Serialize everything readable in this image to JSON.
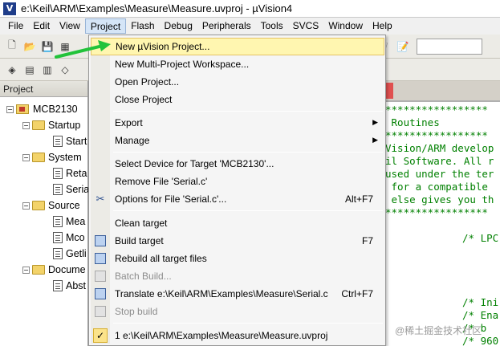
{
  "window": {
    "title": "e:\\Keil\\ARM\\Examples\\Measure\\Measure.uvproj - µVision4",
    "app_icon_letter": "V"
  },
  "menubar": {
    "items": [
      "File",
      "Edit",
      "View",
      "Project",
      "Flash",
      "Debug",
      "Peripherals",
      "Tools",
      "SVCS",
      "Window",
      "Help"
    ]
  },
  "project_panel": {
    "header": "Project",
    "tree": [
      {
        "label": "MCB2130",
        "kind": "target",
        "expander": "−"
      },
      {
        "label": "Startup",
        "kind": "folder",
        "expander": "−"
      },
      {
        "label": "Start",
        "kind": "file"
      },
      {
        "label": "System",
        "kind": "folder",
        "expander": "−"
      },
      {
        "label": "Reta",
        "kind": "file"
      },
      {
        "label": "Seria",
        "kind": "file"
      },
      {
        "label": "Source",
        "kind": "folder",
        "expander": "−"
      },
      {
        "label": "Mea",
        "kind": "file"
      },
      {
        "label": "Mco",
        "kind": "file"
      },
      {
        "label": "Getli",
        "kind": "file"
      },
      {
        "label": "Docume",
        "kind": "folder",
        "expander": "−"
      },
      {
        "label": "Abst",
        "kind": "file"
      }
    ]
  },
  "editor": {
    "lines": [
      "*****************",
      " Routines",
      "*****************",
      "Vision/ARM develop",
      "il Software. All r",
      "used under the ter",
      " for a compatible",
      " else gives you th",
      "*****************",
      "/* LPC",
      "/* Ini",
      "/* Ena",
      "/* b",
      "/* 960"
    ]
  },
  "project_menu": {
    "items": [
      {
        "label": "New µVision Project...",
        "shortcut": "",
        "highlighted": true
      },
      {
        "label": "New Multi-Project Workspace...",
        "shortcut": ""
      },
      {
        "label": "Open Project...",
        "shortcut": ""
      },
      {
        "label": "Close Project",
        "shortcut": ""
      },
      {
        "label": "Export",
        "shortcut": "",
        "submenu": true
      },
      {
        "label": "Manage",
        "shortcut": "",
        "submenu": true
      },
      {
        "label": "Select Device for Target 'MCB2130'...",
        "shortcut": ""
      },
      {
        "label": "Remove File 'Serial.c'",
        "shortcut": ""
      },
      {
        "label": "Options for File 'Serial.c'...",
        "shortcut": "Alt+F7",
        "icon": "options-icon"
      },
      {
        "label": "Clean target",
        "shortcut": ""
      },
      {
        "label": "Build target",
        "shortcut": "F7",
        "icon": "build-icon"
      },
      {
        "label": "Rebuild all target files",
        "shortcut": "",
        "icon": "rebuild-icon"
      },
      {
        "label": "Batch Build...",
        "shortcut": "",
        "disabled": true,
        "icon": "batch-build-icon"
      },
      {
        "label": "Translate e:\\Keil\\ARM\\Examples\\Measure\\Serial.c",
        "shortcut": "Ctrl+F7",
        "icon": "translate-icon"
      },
      {
        "label": "Stop build",
        "shortcut": "",
        "disabled": true,
        "icon": "stop-build-icon"
      },
      {
        "label": "1 e:\\Keil\\ARM\\Examples\\Measure\\Measure.uvproj",
        "shortcut": "",
        "icon": "checkmark-icon"
      }
    ]
  },
  "watermark": "@稀土掘金技术社区",
  "colors": {
    "highlight_bg": "#fff6b0",
    "arrow": "#22c33a",
    "code_green": "#008000"
  }
}
